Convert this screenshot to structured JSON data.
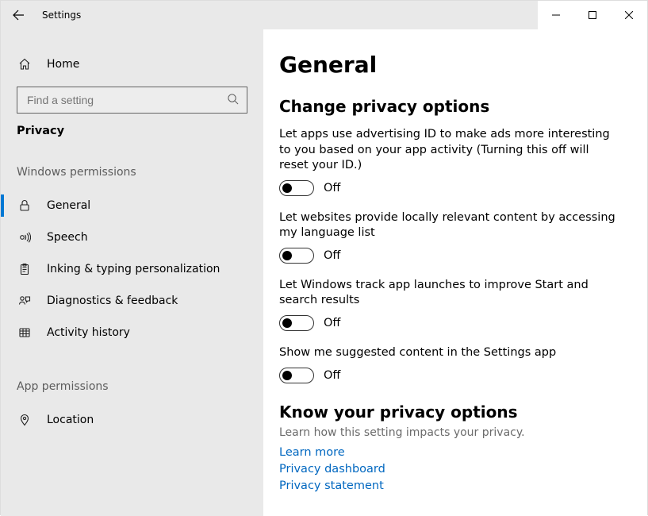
{
  "titlebar": {
    "title": "Settings"
  },
  "sidebar": {
    "home_label": "Home",
    "search_placeholder": "Find a setting",
    "category_title": "Privacy",
    "group1_header": "Windows permissions",
    "group2_header": "App permissions",
    "items_group1": [
      {
        "icon": "lock",
        "label": "General",
        "selected": true
      },
      {
        "icon": "speech",
        "label": "Speech"
      },
      {
        "icon": "clipboard",
        "label": "Inking & typing personalization"
      },
      {
        "icon": "feedback",
        "label": "Diagnostics & feedback"
      },
      {
        "icon": "history",
        "label": "Activity history"
      }
    ],
    "items_group2": [
      {
        "icon": "location",
        "label": "Location"
      }
    ]
  },
  "content": {
    "page_title": "General",
    "section_title": "Change privacy options",
    "settings": [
      {
        "text": "Let apps use advertising ID to make ads more interesting to you based on your app activity (Turning this off will reset your ID.)",
        "state": "Off"
      },
      {
        "text": "Let websites provide locally relevant content by accessing my language list",
        "state": "Off"
      },
      {
        "text": "Let Windows track app launches to improve Start and search results",
        "state": "Off"
      },
      {
        "text": "Show me suggested content in the Settings app",
        "state": "Off"
      }
    ],
    "know_header": "Know your privacy options",
    "know_text": "Learn how this setting impacts your privacy.",
    "links": [
      "Learn more",
      "Privacy dashboard",
      "Privacy statement"
    ]
  }
}
